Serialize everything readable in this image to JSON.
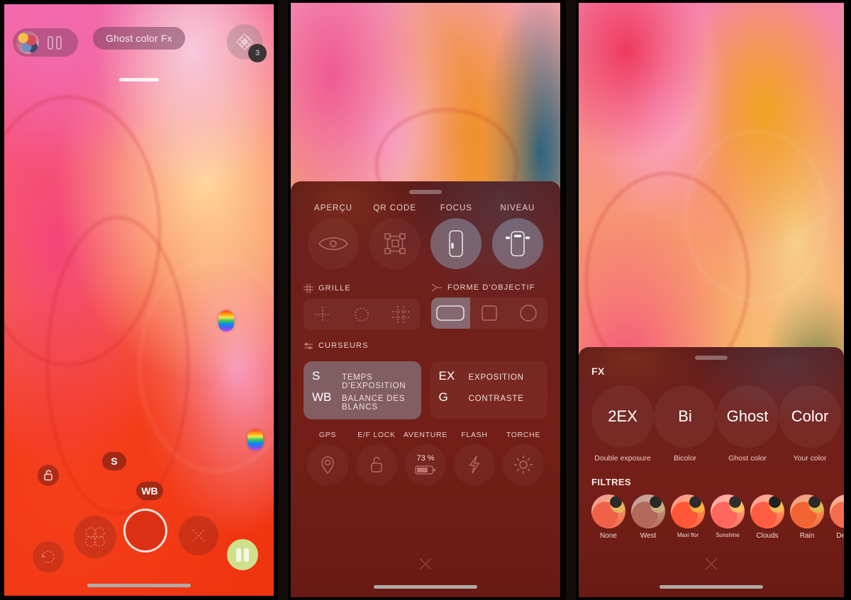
{
  "panel1": {
    "gallery": {
      "name": "gallery-thumbnail",
      "counter_glyph": "00"
    },
    "mode_label": "Ghost color Fx",
    "fx_badge": "3",
    "chips": {
      "shutter_speed": "S",
      "white_balance": "WB"
    },
    "icons": {
      "fx": "flower-fx-icon",
      "lock": "lock-open-icon",
      "undo": "undo-icon",
      "grid": "four-circles-icon",
      "close": "close-icon",
      "pause": "pause-icon",
      "shutter": "shutter-button"
    }
  },
  "panel2": {
    "tiles": [
      {
        "label": "APERÇU",
        "icon": "eye-icon",
        "active": false
      },
      {
        "label": "QR CODE",
        "icon": "qr-code-icon",
        "active": false
      },
      {
        "label": "FOCUS",
        "icon": "focus-phone-icon",
        "active": true
      },
      {
        "label": "NIVEAU",
        "icon": "level-phone-icon",
        "active": true
      }
    ],
    "grid_section": {
      "title": "GRILLE",
      "options": [
        "grid-cross",
        "grid-circle",
        "grid-thirds"
      ],
      "selected_index": -1
    },
    "lens_section": {
      "title": "FORME D'OBJECTIF",
      "options": [
        "lens-wide",
        "lens-square",
        "lens-circle"
      ],
      "selected_index": 0
    },
    "sliders_title": "CURSEURS",
    "slider_groups": [
      {
        "active": true,
        "rows": [
          {
            "key": "S",
            "label": "TEMPS D'EXPOSITION"
          },
          {
            "key": "WB",
            "label": "BALANCE DES BLANCS"
          }
        ]
      },
      {
        "active": false,
        "rows": [
          {
            "key": "EX",
            "label": "EXPOSITION"
          },
          {
            "key": "G",
            "label": "CONTRASTE"
          }
        ]
      }
    ],
    "bottom_tiles": [
      {
        "label": "GPS",
        "icon": "location-pin-icon",
        "value": ""
      },
      {
        "label": "E/F LOCK",
        "icon": "lock-open-icon",
        "value": ""
      },
      {
        "label": "AVENTURE",
        "icon": "battery-icon",
        "value": "73 %"
      },
      {
        "label": "FLASH",
        "icon": "flash-icon",
        "value": ""
      },
      {
        "label": "TORCHE",
        "icon": "torch-sun-icon",
        "value": ""
      }
    ],
    "close_label": "close-sheet"
  },
  "panel3": {
    "fx_title": "FX",
    "fx_items": [
      {
        "badge": "2EX",
        "caption": "Double exposure"
      },
      {
        "badge": "Bi",
        "caption": "Bicolor"
      },
      {
        "badge": "Ghost",
        "caption": "Ghost color"
      },
      {
        "badge": "Color",
        "caption": "Your color"
      }
    ],
    "filters_title": "FILTRES",
    "filters": [
      "None",
      "West",
      "Maxi flor",
      "Sunshine",
      "Clouds",
      "Rain",
      "Desert"
    ],
    "close_label": "close-sheet"
  },
  "colors": {
    "sheet_bg": "#6e201c",
    "active_tile": "#96b4cd",
    "accent_pause": "#cfe08a",
    "home_bar": "#b0aaa6"
  }
}
